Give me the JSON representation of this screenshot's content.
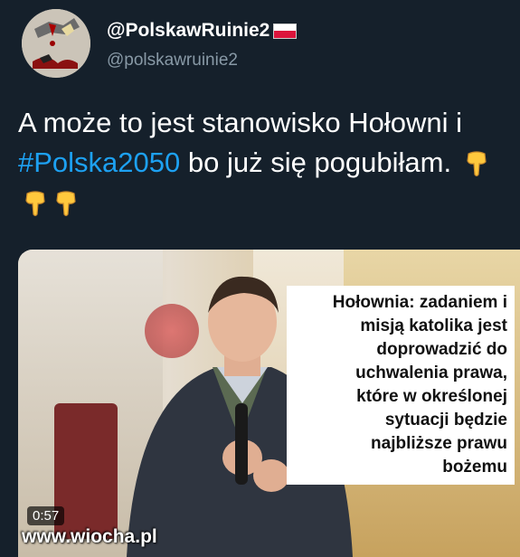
{
  "user": {
    "display_name": "@PolskawRuinie2",
    "handle": "@polskawruinie2",
    "avatar_icon": "avatar-illustration-icon",
    "flag_icon": "poland-flag-icon"
  },
  "tweet": {
    "text_before": "A może to jest stanowisko Hołowni i ",
    "hashtag": "#Polska2050",
    "text_after": " bo już się pogubiłam.",
    "emoji_icon": "pointing-down-hand-icon",
    "hashtag_color": "#1da1f2"
  },
  "media": {
    "caption_lines": [
      "Hołownia: zadaniem i",
      "misją katolika jest",
      "doprowadzić do",
      "uchwalenia prawa,",
      "które w określonej",
      "sytuacji będzie",
      "najbliższe prawu",
      "bożemu"
    ],
    "duration": "0:57",
    "watermark": "www.wiocha.pl"
  },
  "colors": {
    "background": "#15202b",
    "handle": "#8899a6"
  }
}
